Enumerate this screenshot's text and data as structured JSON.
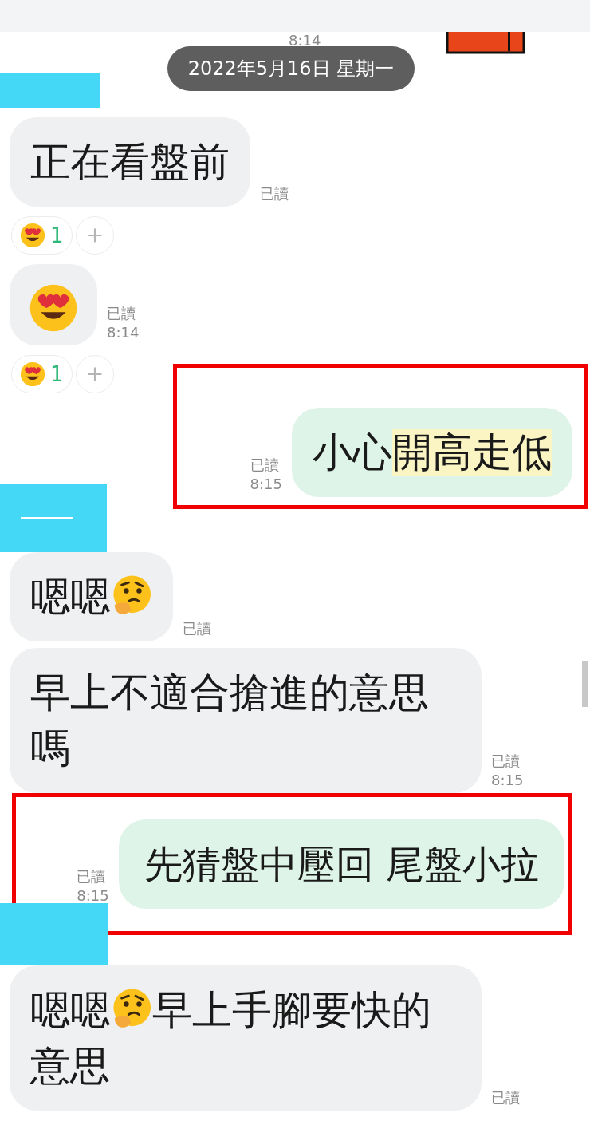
{
  "items": [
    {
      "kind": "sticker",
      "time": "8:14"
    },
    {
      "kind": "date",
      "text": "2022年5月16日 星期一"
    },
    {
      "kind": "redaction",
      "line": false
    },
    {
      "kind": "message",
      "outgoing": false,
      "framed": false,
      "read": "已讀",
      "segments": [
        {
          "kind": "text",
          "text": "正在看盤前",
          "highlighted": false
        }
      ]
    },
    {
      "kind": "reactions",
      "count": "1"
    },
    {
      "kind": "message",
      "outgoing": false,
      "framed": false,
      "read": "已讀",
      "time": "8:14",
      "segments": [
        {
          "kind": "heart-eyes"
        }
      ]
    },
    {
      "kind": "reactions",
      "count": "1"
    },
    {
      "kind": "message",
      "outgoing": true,
      "framed": true,
      "read": "已讀",
      "time": "8:15",
      "segments": [
        {
          "kind": "text",
          "text": "小心",
          "highlighted": false
        },
        {
          "kind": "text",
          "text": "開高走低",
          "highlighted": true
        }
      ]
    },
    {
      "kind": "redaction",
      "line": true
    },
    {
      "kind": "message",
      "outgoing": false,
      "framed": false,
      "read": "已讀",
      "segments": [
        {
          "kind": "text",
          "text": "嗯嗯",
          "highlighted": false
        },
        {
          "kind": "thinking"
        }
      ]
    },
    {
      "kind": "message",
      "outgoing": false,
      "framed": false,
      "read": "已讀",
      "time": "8:15",
      "segments": [
        {
          "kind": "text",
          "text": "早上不適合搶進的意思嗎",
          "highlighted": false
        }
      ]
    },
    {
      "kind": "message",
      "outgoing": true,
      "framed": true,
      "read": "已讀",
      "time": "8:15",
      "segments": [
        {
          "kind": "text",
          "text": "先猜盤中壓回 尾盤小拉",
          "highlighted": false
        }
      ]
    },
    {
      "kind": "redaction",
      "line": false
    },
    {
      "kind": "message",
      "outgoing": false,
      "framed": false,
      "read": "已讀",
      "segments": [
        {
          "kind": "text",
          "text": "嗯嗯",
          "highlighted": false
        },
        {
          "kind": "thinking"
        },
        {
          "kind": "text",
          "text": "早上手腳要快的意思",
          "highlighted": false
        }
      ]
    }
  ]
}
